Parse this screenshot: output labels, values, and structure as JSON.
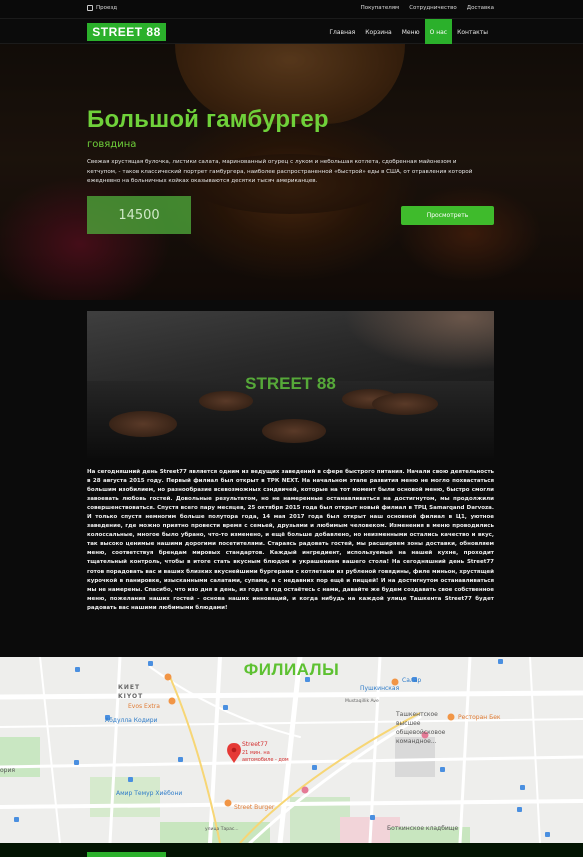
{
  "utility": {
    "location": "Проезд",
    "links": [
      "Покупателям",
      "Сотрудничество",
      "Доставка"
    ]
  },
  "nav": {
    "logo": "STREET 88",
    "items": [
      {
        "label": "Главная",
        "active": false
      },
      {
        "label": "Корзина",
        "active": false
      },
      {
        "label": "Меню",
        "active": false
      },
      {
        "label": "О нас",
        "active": true
      },
      {
        "label": "Контакты",
        "active": false
      }
    ]
  },
  "hero": {
    "title": "Большой гамбургер",
    "subtitle": "говядина",
    "description": "Свежая хрустящая булочка, листики салата, маринованный огурец с луком и небольшая котлета, сдобренная майонезом и кетчупом, - таков классический портрет гамбургера, наиболее распространенной «быстрой» еды в США, от отравления которой ежедневно на больничных койках оказываются десятки тысяч американцев.",
    "price": "14500",
    "button": "Просмотреть"
  },
  "video": {
    "brand": "STREET 88"
  },
  "about": {
    "text": "На сегодняшний день Street77 является одним из ведущих заведений в сфере быстрого питания. Начали свою деятельность в 28 августа 2015 году. Первый филиал был открыт в ТРК NEXT. На начальном этапе развития меню не могло похвастаться большим изобилием, но разнообразие всевозможных сэндвичей, которые на тот момент были основой меню, быстро смогли завоевать любовь гостей. Довольные результатом, но не намеренные останавливаться на достигнутом, мы продолжили совершенствоваться. Спустя всего пару месяцев, 25 октября 2015 года был открыт новый филиал в ТРЦ Samarqand Darvoza. И только спустя немногим больше полутора года, 14 мая 2017 года был открыт наш основной филиал в Ц1, уютное заведение, где можно приятно провести время с семьей, друзьями и любимым человеком. Изменения в меню проводились колоссальные, многое было убрано, что-то изменено, и ещё больше добавлено, но неизменными остались качество и вкус, так высоко ценимые нашими дорогими посетителями. Стараясь радовать гостей, мы расширяем зоны доставки, обновляем меню, соответствуя брендам мировых стандартов. Каждый ингредиент, используемый на нашей кухне, проходит тщательный контроль, чтобы в итоге стать вкусным блюдом и украшением вашего стола! На сегодняшний день Street77 готов порадовать вас и ваших близких вкуснейшими бургерами с котлетами из рубленой говядины, филе миньон, хрустящей курочкой в панировке, изысканными салатами, супами, а с недавних пор ещё и пиццей! И на достигнутом останавливаться мы не намерены. Спасибо, что изо дня в день, из года в год остаётесь с нами, давайте же будем создавать свое собственное меню, пожелания наших гостей - основа наших инноваций, и когда нибудь на каждой улице Ташкента Street77 будет радовать вас нашими любимыми блюдами!"
  },
  "branches": {
    "title": "ФИЛИАЛЫ",
    "map_labels": {
      "kiet": "КИЕТ",
      "kiyot": "KIYOT",
      "evos": "Evos Extra",
      "abdulla": "Абдулла Кодири",
      "amir": "Амир Темур Хиёбони",
      "street_burger": "Street Burger",
      "pin_title": "Street77",
      "pin_sub1": "21 мин. на",
      "pin_sub2": "автомобиле - дом",
      "salar": "Салар",
      "pushkin": "Пушкинская",
      "mustaqillik": "Mustaqillik Ave",
      "tashkent_school1": "Ташкентское",
      "tashkent_school2": "высшее",
      "tashkent_school3": "общевойсковое",
      "tashkent_school4": "командное...",
      "restoran": "Ресторан Бек",
      "botkin": "Боткинское кладбище",
      "oriya": "ория",
      "ulitsa": "улица Тарас..."
    }
  },
  "colors": {
    "accent_green": "#2bb02b",
    "title_green": "#6fd13a",
    "map_pin_red": "#e53935"
  }
}
